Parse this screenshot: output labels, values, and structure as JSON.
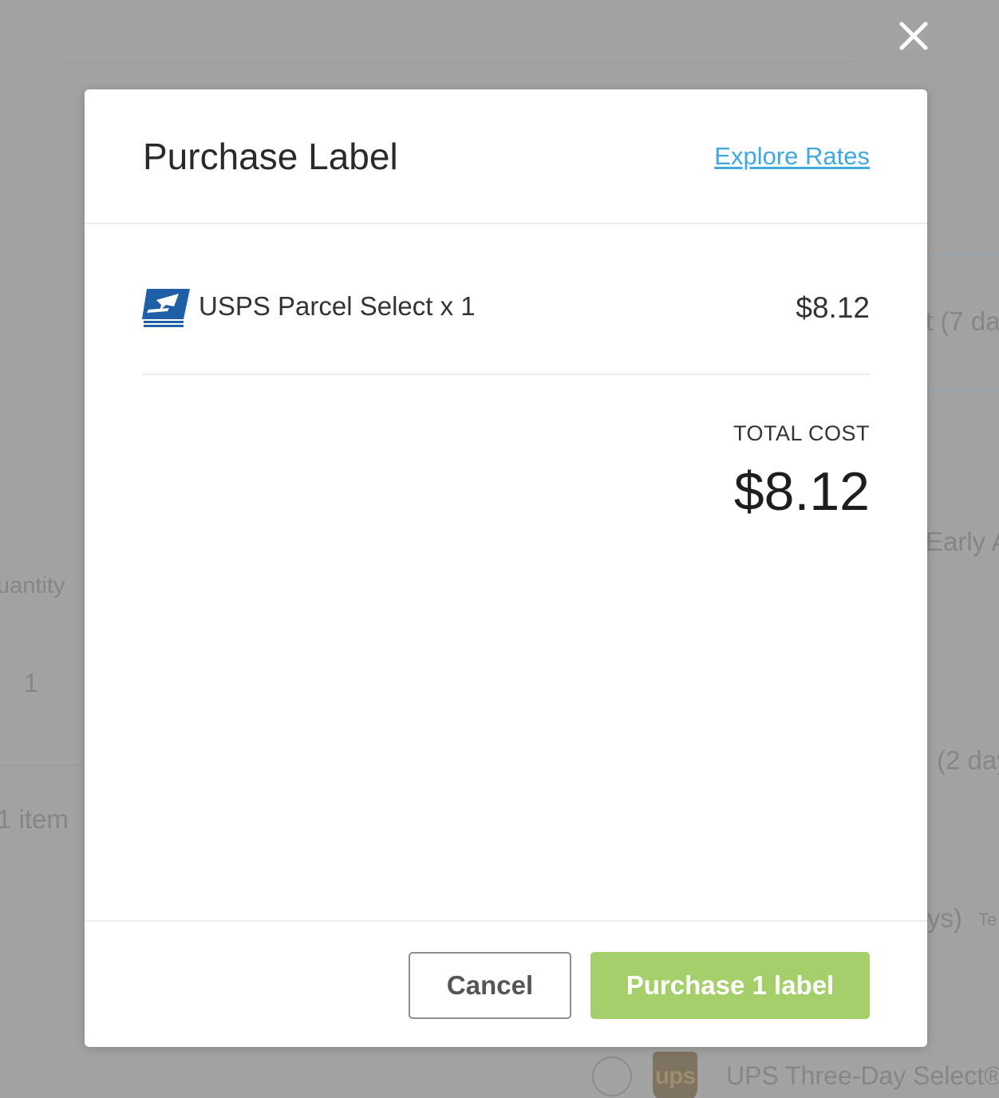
{
  "modal": {
    "title": "Purchase Label",
    "explore_rates_link": "Explore Rates",
    "line_item": {
      "carrier_logo": "usps-eagle-logo",
      "service": "USPS Parcel Select x 1",
      "price": "$8.12"
    },
    "total_label": "TOTAL COST",
    "total_amount": "$8.12",
    "buttons": {
      "cancel": "Cancel",
      "purchase": "Purchase 1 label"
    }
  },
  "background": {
    "column_header_quantity": "uantity",
    "quantity_value": "1",
    "item_count": "1 item",
    "rate_fragment_1": "t (7 da",
    "rate_fragment_2": "Early A",
    "rate_fragment_3": "(2 day",
    "rate_fragment_4": "ys)",
    "rate_fragment_5": "Te",
    "ups_logo_text": "ups",
    "ups_service": "UPS Three-Day Select®"
  },
  "colors": {
    "overlay": "#a3a3a3",
    "link": "#3fa9e0",
    "purchase_button": "#a4cf6a",
    "usps_blue": "#1f5fa8"
  },
  "icons": {
    "close": "close-icon"
  }
}
